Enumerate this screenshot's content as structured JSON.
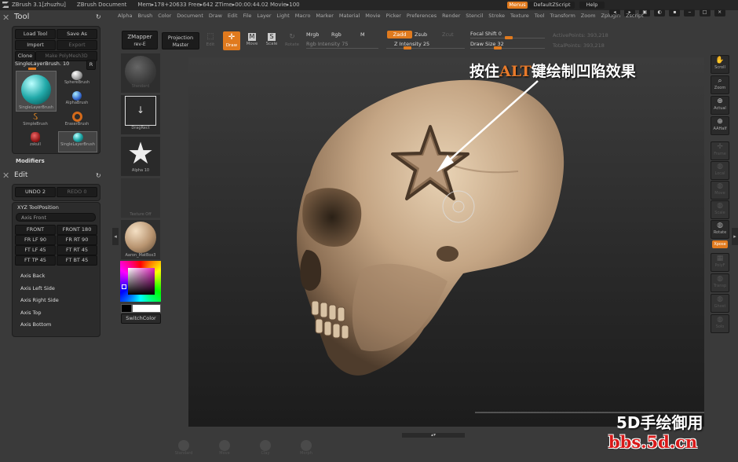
{
  "title_bar": {
    "app": "ZBrush 3.1[zhuzhu]",
    "document": "ZBrush Document",
    "stats": "Mem▸178+20633 Free▸642 ZTime▸00:00:44.02 Movie▸100",
    "menus_btn": "Menus",
    "script_btn": "DefaultZScript",
    "help_btn": "Help"
  },
  "menu_bar": [
    "Alpha",
    "Brush",
    "Color",
    "Document",
    "Draw",
    "Edit",
    "File",
    "Layer",
    "Light",
    "Macro",
    "Marker",
    "Material",
    "Movie",
    "Picker",
    "Preferences",
    "Render",
    "Stencil",
    "Stroke",
    "Texture",
    "Tool",
    "Transform",
    "Zoom",
    "Zplugin",
    "Zscript"
  ],
  "toolbar": {
    "zmapper": "ZMapper",
    "zmapper_sub": "rev-E",
    "projection": "Projection",
    "projection_sub": "Master",
    "edit": "Edit",
    "draw": "Draw",
    "move": "Move",
    "scale": "Scale",
    "rotate": "Rotate",
    "mrgb": "Mrgb",
    "rgb": "Rgb",
    "m": "M",
    "rgb_intensity": "Rgb Intensity 75",
    "zadd": "Zadd",
    "zsub": "Zsub",
    "zcut": "Zcut",
    "z_intensity": "Z Intensity 25",
    "focal_shift": "Focal Shift 0",
    "draw_size": "Draw Size 32",
    "active_points": "ActivePoints: 393,218",
    "total_points": "TotalPoints: 393,218"
  },
  "tool_panel": {
    "header": "Tool",
    "load_tool": "Load Tool",
    "save_as": "Save As",
    "import": "Import",
    "export": "Export",
    "clone": "Clone",
    "make_polymesh": "Make PolyMesh3D",
    "current": "SingleLayerBrush. 10",
    "r": "R",
    "thumb_main": "SingleLayerBrush",
    "thumbs": [
      "SphereBrush",
      "AlphaBrush",
      "SimpleBrush",
      "EraserBrush",
      "zskull",
      "SingleLayerBrush"
    ],
    "modifiers": "Modifiers"
  },
  "edit_panel": {
    "header": "Edit",
    "undo": "UNDO 2",
    "redo": "REDO 0"
  },
  "xyz_panel": {
    "header": "XYZ ToolPosition",
    "axis_front": "Axis Front",
    "buttons": [
      "FRONT",
      "FRONT 180",
      "FR LF 90",
      "FR RT 90",
      "FT LF 45",
      "FT RT 45",
      "FT TP 45",
      "FT BT 45"
    ],
    "axis_items": [
      "Axis Back",
      "Axis Left Side",
      "Axis Right Side",
      "Axis Top",
      "Axis Bottom"
    ]
  },
  "left_shelf": {
    "standard": "Standard",
    "dragrect": "DragRect",
    "alpha": "Alpha 10",
    "texture": "Texture Off",
    "material": "Aaron_MatBox3",
    "switch_color": "SwitchColor"
  },
  "right_shelf": [
    "Scroll",
    "Zoom",
    "Actual",
    "AAHalf",
    "Frame",
    "Local",
    "Move",
    "Scale",
    "Rotate",
    "Xpose",
    "PolyF",
    "Transp",
    "Ghost",
    "Solo"
  ],
  "bottom_shelf": [
    "Standard",
    "Move",
    "Clay",
    "Morph"
  ],
  "annotation": {
    "text_before": "按住",
    "text_highlight": "ALT",
    "text_after": "键绘制凹陷效果",
    "highlight_color": "#e87a2a"
  },
  "watermark": {
    "line1": "5D手绘御用",
    "line2": "bbs.5d.cn"
  },
  "colors": {
    "accent": "#e07a1e",
    "panel": "#2c2c2c",
    "skull": "#c8ad8e"
  }
}
